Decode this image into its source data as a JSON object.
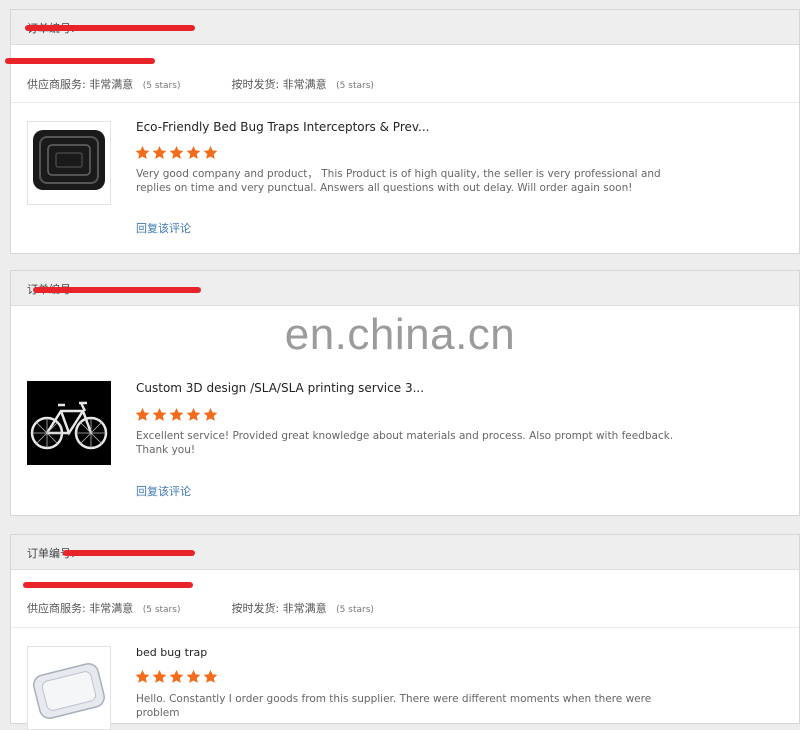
{
  "reviews": [
    {
      "order_label": "订单编号:",
      "buyer_line": "",
      "supplier_service_label": "供应商服务:",
      "supplier_service_value": "非常满意",
      "supplier_service_stars": "(5 stars)",
      "ontime_label": "按时发货:",
      "ontime_value": "非常满意",
      "ontime_stars": "(5 stars)",
      "product_title": "Eco-Friendly Bed Bug Traps Interceptors & Prev...",
      "rating": 5,
      "review_text": "Very good company and product， This Product is of high quality, the seller is very professional and replies on time and very punctual.  Answers all questions with out delay. Will order again soon!",
      "reply_link": "回复该评论",
      "thumb_icon": "black-tray-icon"
    },
    {
      "order_label": "订单编号:",
      "product_title": "Custom 3D design /SLA/SLA printing service 3...",
      "rating": 5,
      "review_text": "Excellent service! Provided great knowledge about materials and process. Also prompt with feedback. Thank you!",
      "reply_link": "回复该评论",
      "thumb_icon": "bicycle-icon"
    },
    {
      "order_label": "订单编号:",
      "supplier_service_label": "供应商服务:",
      "supplier_service_value": "非常满意",
      "supplier_service_stars": "(5 stars)",
      "ontime_label": "按时发货:",
      "ontime_value": "非常满意",
      "ontime_stars": "(5 stars)",
      "product_title": "bed bug trap",
      "rating": 5,
      "review_text": "Hello. Constantly I order goods from this supplier. There were different moments when there were problem",
      "thumb_icon": "white-tray-icon"
    }
  ],
  "watermark": "en.china.cn",
  "colors": {
    "star": "#f26c1b",
    "redaction": "#e8232a",
    "link": "#3e78b7"
  }
}
